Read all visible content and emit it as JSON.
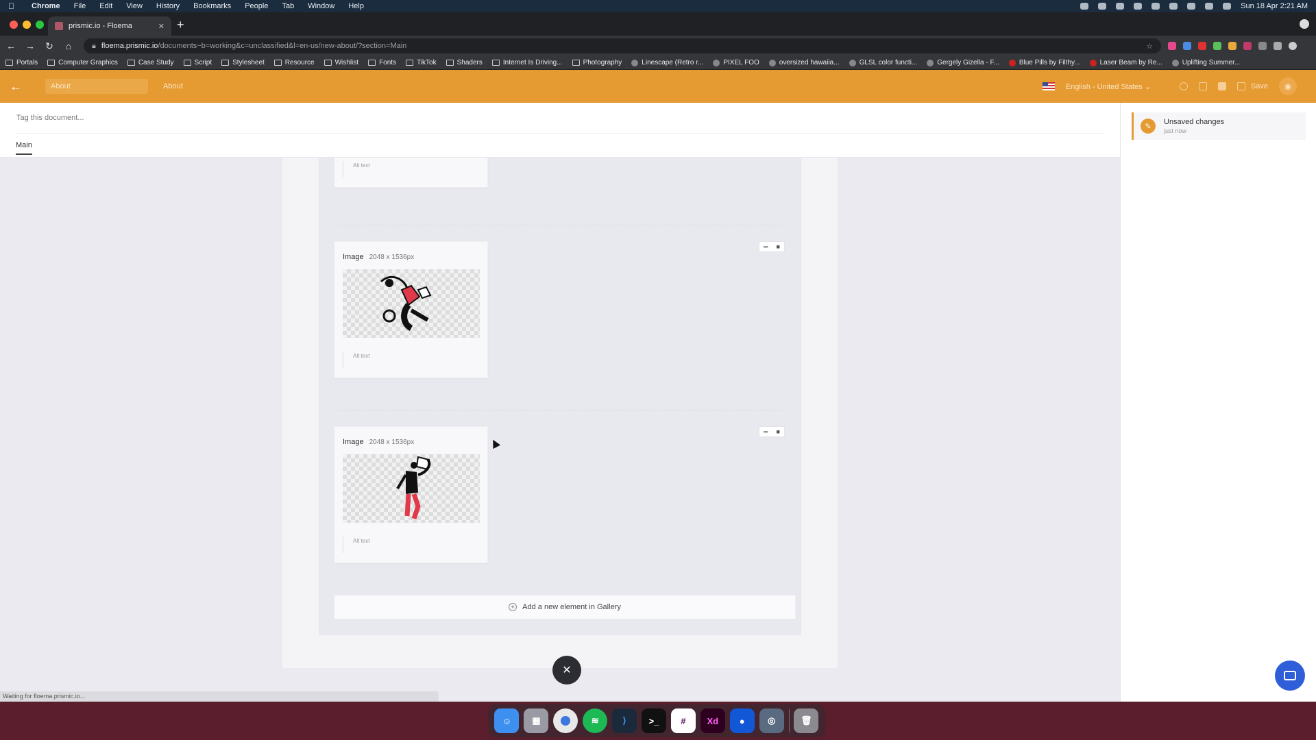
{
  "menubar": {
    "app": "Chrome",
    "items": [
      "File",
      "Edit",
      "View",
      "History",
      "Bookmarks",
      "People",
      "Tab",
      "Window",
      "Help"
    ],
    "clock": "Sun 18 Apr  2:21 AM"
  },
  "browser": {
    "tab_title": "prismic.io - Floema",
    "url_host": "floema.prismic.io",
    "url_path": "/documents~b=working&c=unclassified&l=en-us/new-about/?section=Main",
    "bookmarks": [
      "Portals",
      "Computer Graphics",
      "Case Study",
      "Script",
      "Stylesheet",
      "Resource",
      "Wishlist",
      "Fonts",
      "TikTok",
      "Shaders",
      "Internet Is Driving...",
      "Photography",
      "Linescape (Retro r...",
      "PIXEL FOO",
      "oversized hawaiia...",
      "GLSL color functi...",
      "Gergely Gizella - F...",
      "Blue Pills by Filthy...",
      "Laser Beam by Re...",
      "Uplifting Summer..."
    ]
  },
  "header": {
    "doc_title": "About",
    "crumb": "About",
    "language": "English - United States",
    "save_label": "Save"
  },
  "tagbar": {
    "placeholder": "Tag this document...",
    "tab_main": "Main"
  },
  "status_panel": {
    "title": "Unsaved changes",
    "time": "just now"
  },
  "gallery": {
    "alt_label": "Alt text",
    "items": [
      {
        "label": "Image",
        "dims": "2048 x 1536px",
        "alt": "Alt text"
      },
      {
        "label": "Image",
        "dims": "2048 x 1536px",
        "alt": "Alt text"
      }
    ],
    "add_label": "Add a new element in Gallery"
  },
  "statusbar": "Waiting for floema.prismic.io...",
  "colors": {
    "brand": "#e59a32",
    "fab": "#2c2c33",
    "chat": "#2f5ed8"
  },
  "dock": [
    "Finder",
    "Launchpad",
    "Chrome",
    "Spotify",
    "VS Code",
    "Terminal",
    "Slack",
    "Adobe XD",
    "Copilot",
    "Screen Capture",
    "Trash"
  ]
}
